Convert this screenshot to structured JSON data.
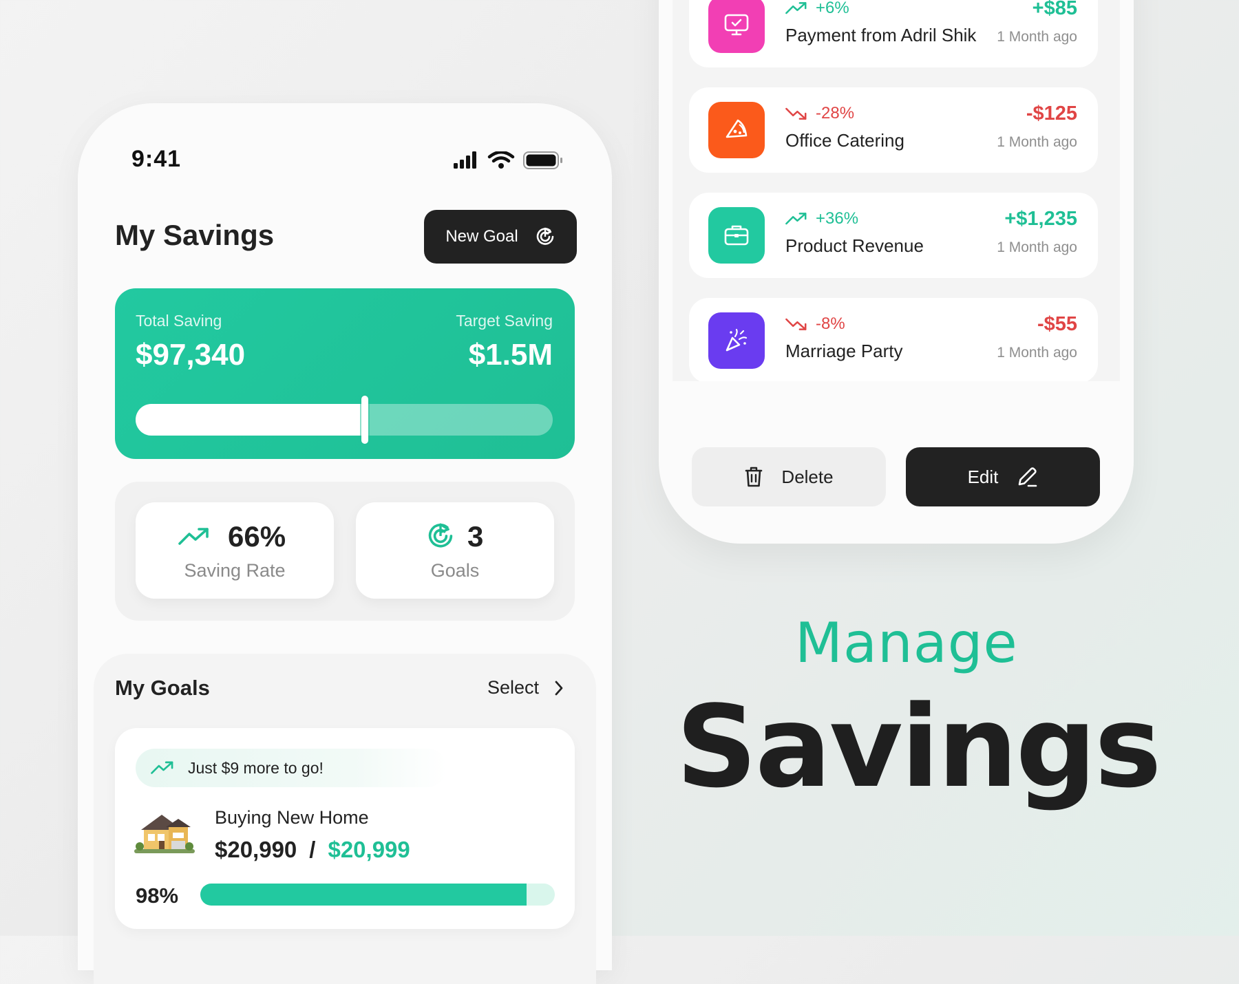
{
  "status_bar": {
    "time": "9:41",
    "icons": [
      "cellular-signal-icon",
      "wifi-icon",
      "battery-icon"
    ]
  },
  "header": {
    "title": "My Savings",
    "new_goal_label": "New Goal",
    "new_goal_icon": "target-icon"
  },
  "saving_card": {
    "total_label": "Total Saving",
    "total_value": "$97,340",
    "target_label": "Target Saving",
    "target_value": "$1.5M",
    "progress_fraction": 0.55,
    "color": "#1fbf95"
  },
  "stats": [
    {
      "value": "66%",
      "caption": "Saving Rate",
      "icon": "trend-up-icon"
    },
    {
      "value": "3",
      "caption": "Goals",
      "icon": "target-icon"
    }
  ],
  "goals": {
    "title": "My Goals",
    "select_label": "Select",
    "items": [
      {
        "tip": "Just $9 more to go!",
        "name": "Buying New Home",
        "current": "$20,990",
        "separator": "/",
        "target": "$20,999",
        "percent_label": "98%",
        "progress_fraction": 0.92,
        "icon": "house-icon"
      }
    ]
  },
  "transactions": [
    {
      "icon": "monitor-icon",
      "icon_color": "#f23fb4",
      "change": "+6%",
      "trend": "up",
      "name": "Payment from Adril Shik",
      "amount": "+$85",
      "time": "1 Month ago"
    },
    {
      "icon": "pizza-icon",
      "icon_color": "#fb5a1b",
      "change": "-28%",
      "trend": "down",
      "name": "Office Catering",
      "amount": "-$125",
      "time": "1 Month ago"
    },
    {
      "icon": "briefcase-icon",
      "icon_color": "#22c9a0",
      "change": "+36%",
      "trend": "up",
      "name": "Product Revenue",
      "amount": "+$1,235",
      "time": "1 Month ago"
    },
    {
      "icon": "party-popper-icon",
      "icon_color": "#6a3cf0",
      "change": "-8%",
      "trend": "down",
      "name": "Marriage Party",
      "amount": "-$55",
      "time": "1 Month ago"
    }
  ],
  "actions": {
    "delete_label": "Delete",
    "edit_label": "Edit"
  },
  "headline": {
    "line1": "Manage",
    "line2": "Savings"
  },
  "colors": {
    "accent": "#1fbf95",
    "negative": "#e04545",
    "dark": "#222222"
  }
}
